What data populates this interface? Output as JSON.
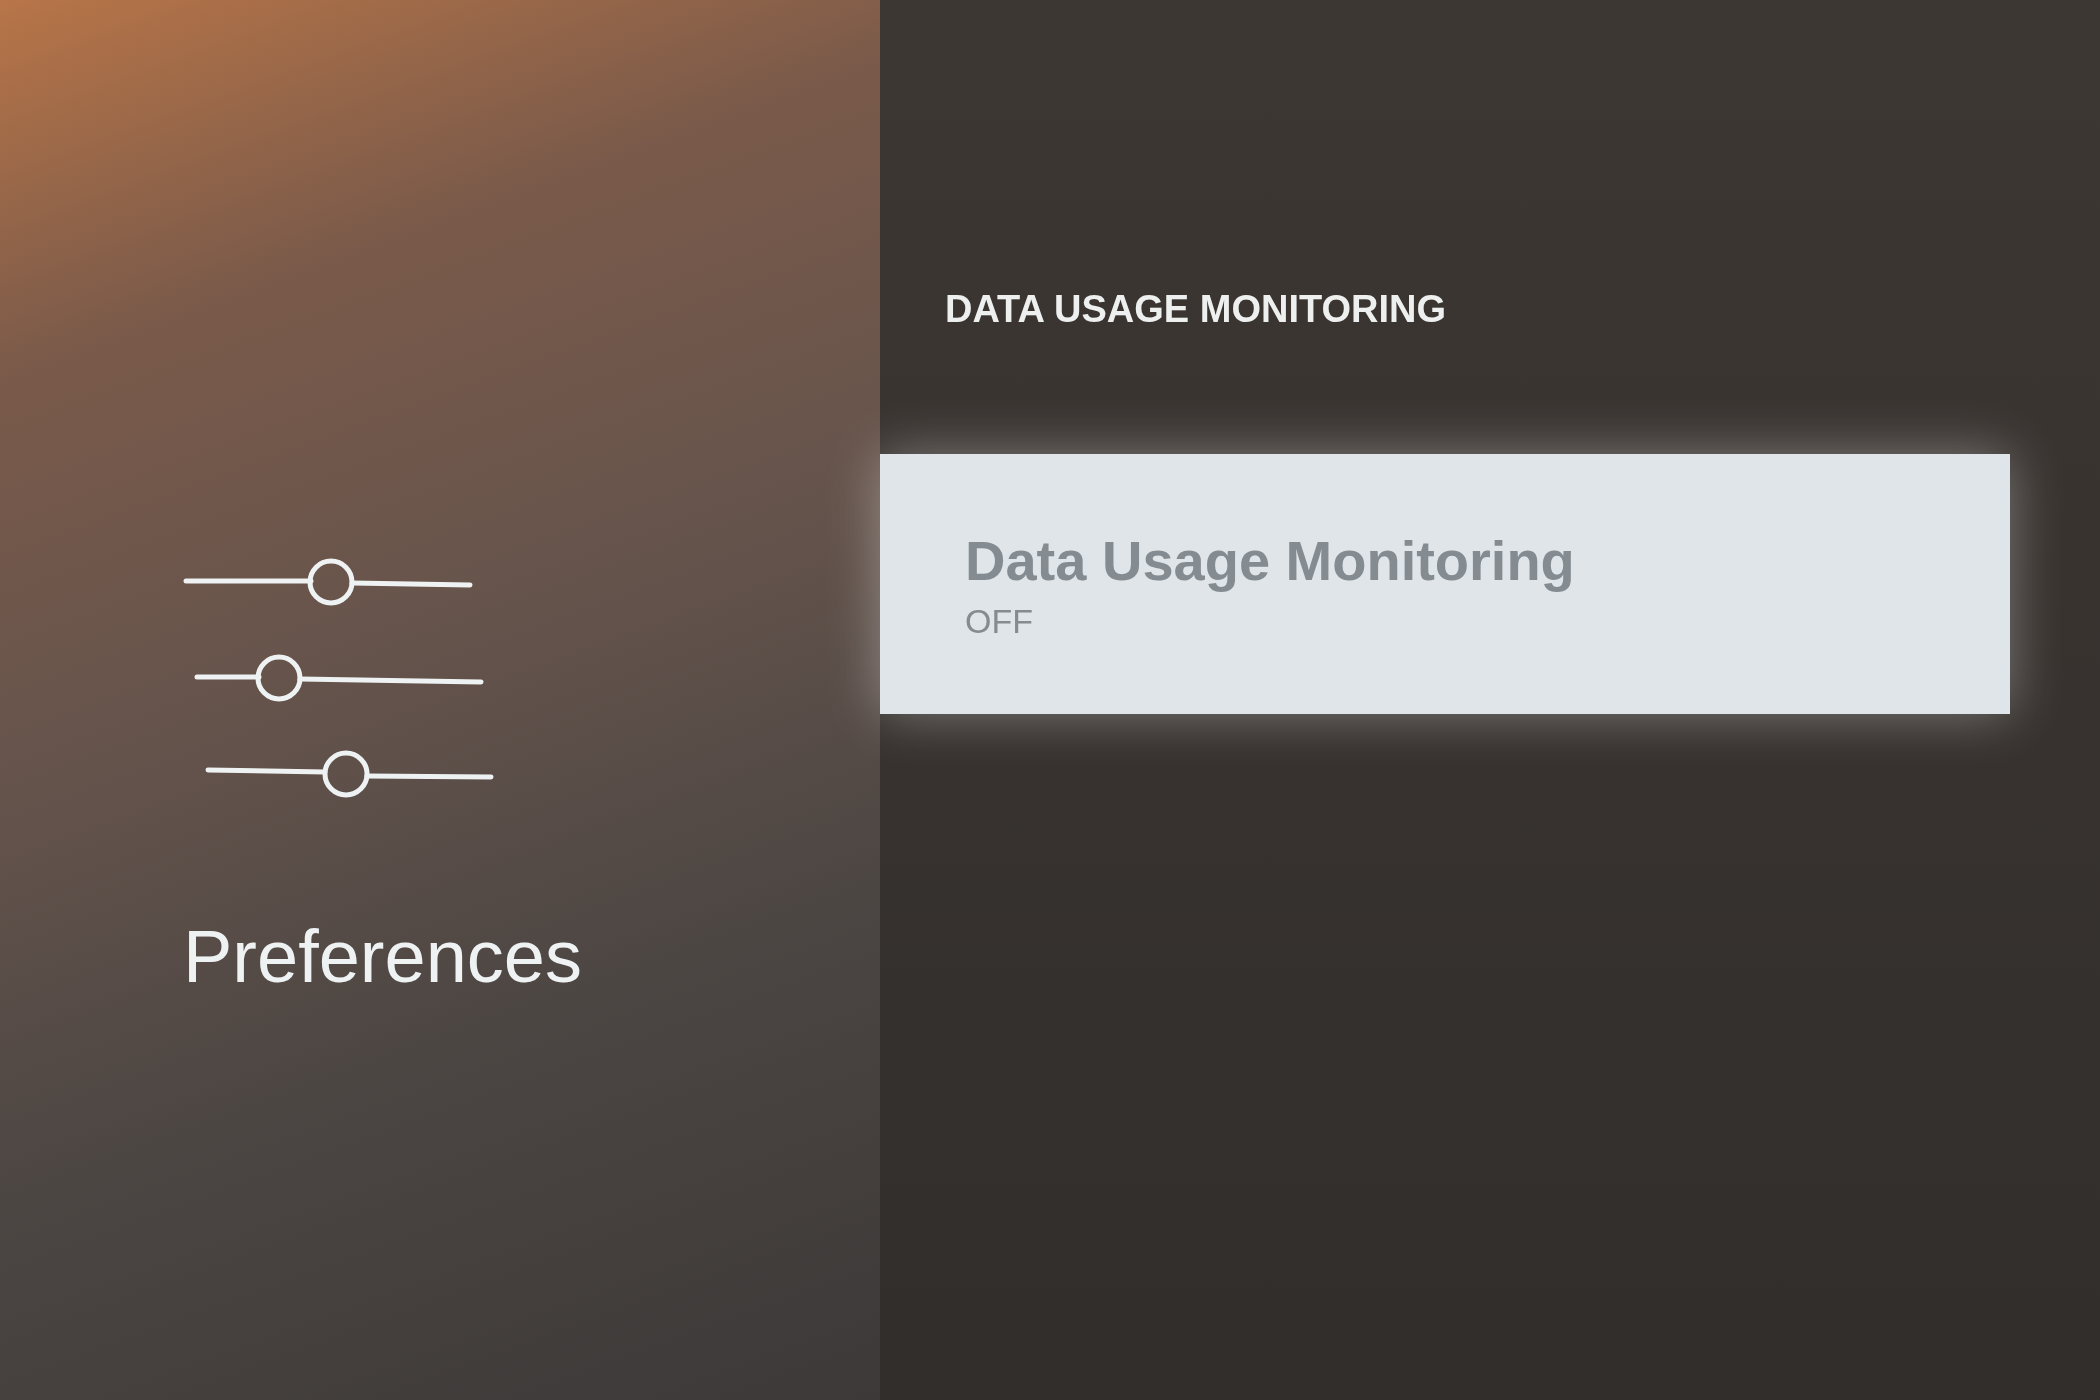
{
  "sidebar": {
    "title": "Preferences"
  },
  "section": {
    "heading": "DATA USAGE MONITORING",
    "items": [
      {
        "label": "Data Usage Monitoring",
        "value": "OFF",
        "selected": true
      }
    ]
  }
}
